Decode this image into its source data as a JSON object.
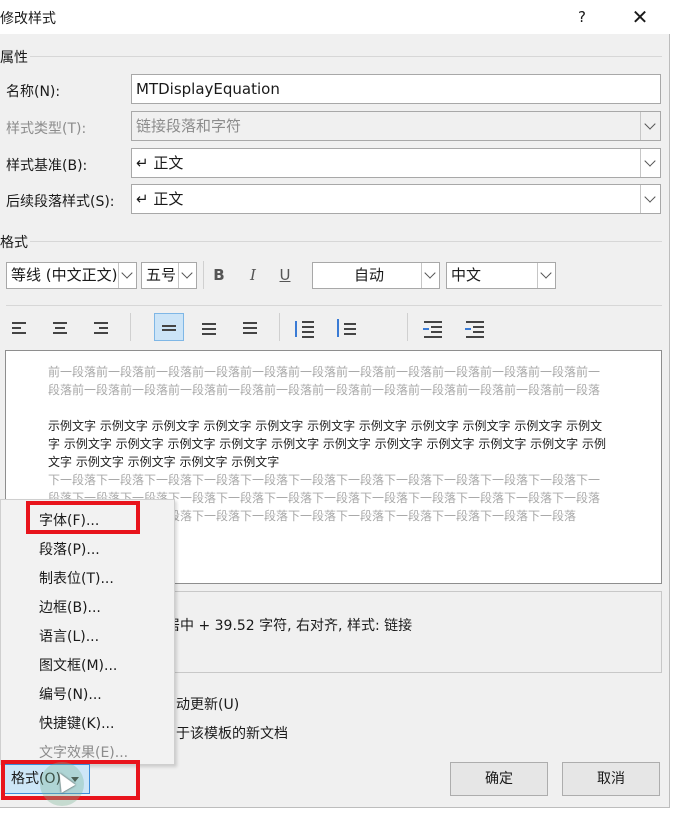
{
  "dialog": {
    "title": "修改样式",
    "help_label": "?",
    "close_label": "✕"
  },
  "properties": {
    "section_label": "属性",
    "name_label": "名称(N):",
    "name_value": "MTDisplayEquation",
    "style_type_label": "样式类型(T):",
    "style_type_value": "链接段落和字符",
    "based_on_label": "样式基准(B):",
    "based_on_value": "↵ 正文",
    "next_style_label": "后续段落样式(S):",
    "next_style_value": "↵ 正文"
  },
  "format": {
    "section_label": "格式",
    "font_value": "等线 (中文正文)",
    "size_value": "五号",
    "bold_label": "B",
    "italic_label": "I",
    "underline_label": "U",
    "color_value": "自动",
    "script_value": "中文"
  },
  "preview": {
    "before_text": "前一段落前一段落前一段落前一段落前一段落前一段落前一段落前一段落前一段落前一段落前一段落前一段落前一段落前一段落前一段落前一段落前一段落前一段落前一段落前一段落前一段落前一段落前一段落",
    "sample_text": "示例文字 示例文字 示例文字 示例文字 示例文字 示例文字 示例文字 示例文字 示例文字 示例文字 示例文字 示例文字 示例文字 示例文字 示例文字 示例文字 示例文字 示例文字 示例文字 示例文字 示例文字 示例文字 示例文字 示例文字 示例文字 示例文字",
    "after_text": "下一段落下一段落下一段落下一段落下一段落下一段落下一段落下一段落下一段落下一段落下一段落下一段落下一段落下一段落下一段落下一段落下一段落下一段落下一段落下一段落下一段落下一段落下一段落下一段落下一段落下一段落下一段落下一段落下一段落下一段落下一段落下一段落下一段落下一段落"
  },
  "description": {
    "text": "居中 +  39.52 字符, 右对齐, 样式: 链接"
  },
  "options": {
    "auto_update_label": "动更新(U)",
    "new_docs_label": "于该模板的新文档"
  },
  "menu": {
    "items": [
      {
        "label": "字体(F)..."
      },
      {
        "label": "段落(P)..."
      },
      {
        "label": "制表位(T)..."
      },
      {
        "label": "边框(B)..."
      },
      {
        "label": "语言(L)..."
      },
      {
        "label": "图文框(M)..."
      },
      {
        "label": "编号(N)..."
      },
      {
        "label": "快捷键(K)..."
      },
      {
        "label": "文字效果(E)..."
      }
    ]
  },
  "buttons": {
    "format_label": "格式(O)",
    "ok_label": "确定",
    "cancel_label": "取消"
  },
  "colors": {
    "highlight": "#e8141c",
    "selected": "#cde6f7"
  }
}
